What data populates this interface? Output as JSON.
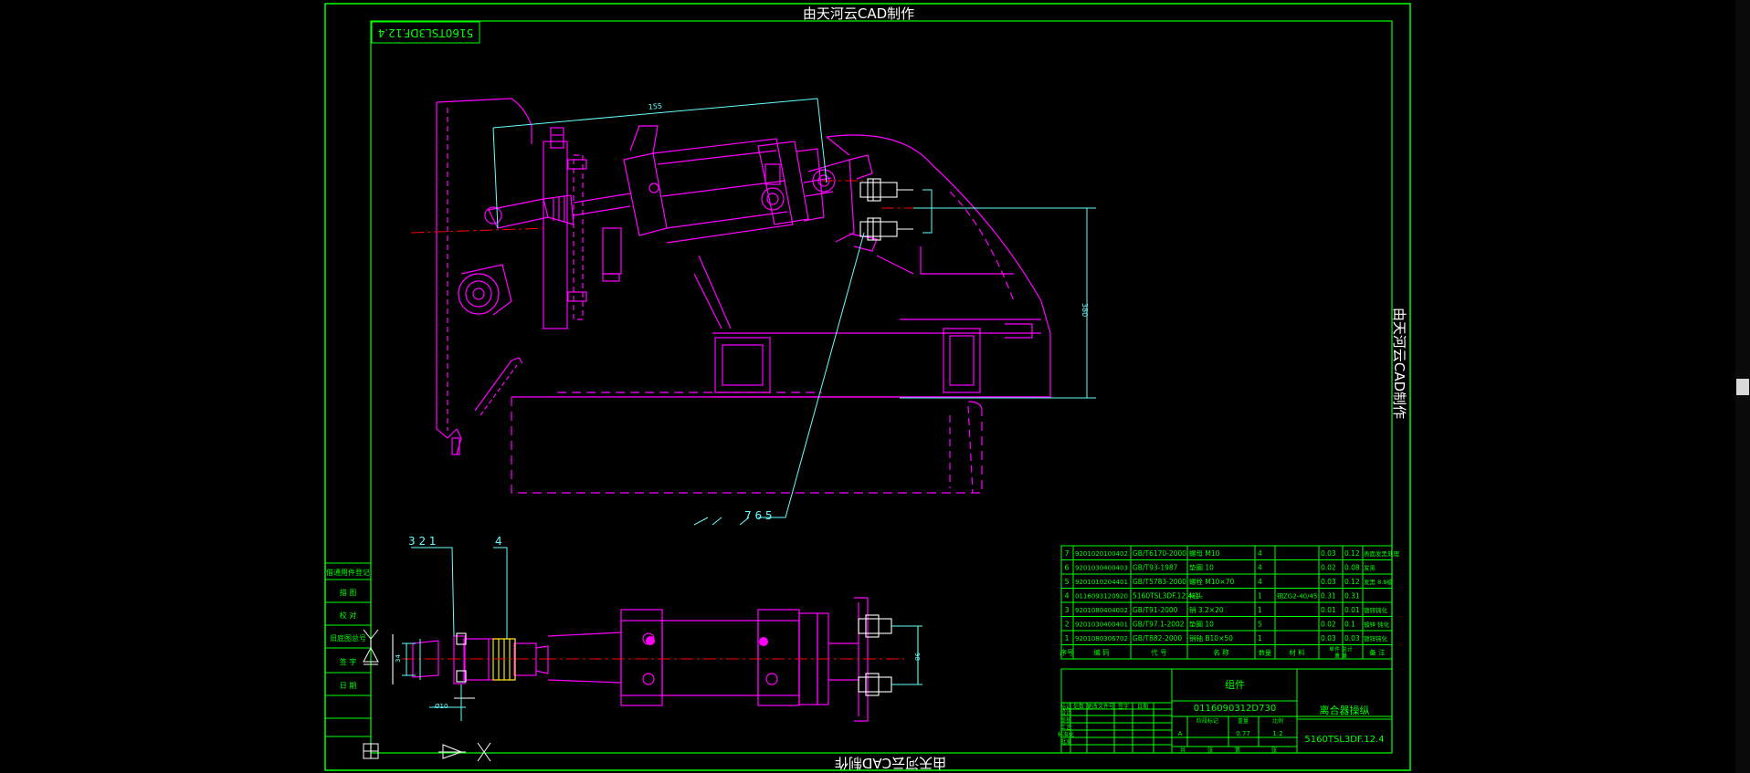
{
  "banner": {
    "top": "由天河云CAD制作",
    "bottom": "由天河云CAD制作",
    "right": "由天河云CAD制作"
  },
  "drawing_code_box": "5160TSL3DF.12.4",
  "callouts": {
    "main_leader": "7  6  5",
    "left_group": "3  2  1",
    "left_single": "4"
  },
  "side_table": {
    "rows": [
      "借通用件登记",
      "描 图",
      "校 对",
      "旧底图总号",
      "签 字",
      "日 期"
    ]
  },
  "bom": {
    "rows": [
      {
        "no": "7",
        "code": "9201020100402",
        "std": "GB/T6170-2000",
        "name": "螺母 M10",
        "qty": "4",
        "mat": "",
        "w1": "0.03",
        "w2": "0.12",
        "note": "表面发黑处理"
      },
      {
        "no": "6",
        "code": "9201030400403",
        "std": "GB/T93-1987",
        "name": "垫圈 10",
        "qty": "4",
        "mat": "",
        "w1": "0.02",
        "w2": "0.08",
        "note": "发黑"
      },
      {
        "no": "5",
        "code": "9201010204401",
        "std": "GB/T5783-2000",
        "name": "螺栓 M10×70",
        "qty": "4",
        "mat": "",
        "w1": "0.03",
        "w2": "0.12",
        "note": "发黑 8.8级"
      },
      {
        "no": "4",
        "code": "0116093120920",
        "std": "5160TSL3DF.12.4-1",
        "name": "接头",
        "qty": "1",
        "mat": "钢ZG2-40/45",
        "w1": "0.31",
        "w2": "0.31",
        "note": ""
      },
      {
        "no": "3",
        "code": "9201080404002",
        "std": "GB/T91-2000",
        "name": "销 3.2×20",
        "qty": "1",
        "mat": "",
        "w1": "0.01",
        "w2": "0.01",
        "note": "镀锌钝化"
      },
      {
        "no": "2",
        "code": "9201030400401",
        "std": "GB/T97.1-2002",
        "name": "垫圈 10",
        "qty": "5",
        "mat": "",
        "w1": "0.02",
        "w2": "0.1",
        "note": "镀锌 钝化"
      },
      {
        "no": "1",
        "code": "9201080306702",
        "std": "GB/T882-2000",
        "name": "销轴 B10×50",
        "qty": "1",
        "mat": "",
        "w1": "0.03",
        "w2": "0.03",
        "note": "镀锌钝化"
      }
    ],
    "header": {
      "no": "序号",
      "code": "编 码",
      "std": "代 号",
      "name": "名 称",
      "qty": "数量",
      "mat": "材 料",
      "w": "单件 总计",
      "wsub": "重 量",
      "note": "备 注"
    }
  },
  "title_block": {
    "group_label": "组件",
    "part_code": "0116090312D730",
    "part_name": "离合器操纵",
    "drawing_no": "5160TSL3DF.12.4",
    "weight": "0.77",
    "scale": "1:2",
    "stage": "A",
    "labels_row1": [
      "标记",
      "处数",
      "更改文件号",
      "签字",
      "日期"
    ],
    "labels_rows": [
      "设计",
      "审核",
      "工艺",
      "标准化",
      "批准"
    ],
    "labels_right": [
      "阶段标记",
      "重量",
      "比例"
    ],
    "sheet": [
      "共",
      "张",
      "第",
      "张"
    ]
  },
  "dims": {
    "top_dim": "155",
    "right_dim": "380",
    "left_dim": "34",
    "small_dim": "Ø10",
    "right_small": "98"
  }
}
